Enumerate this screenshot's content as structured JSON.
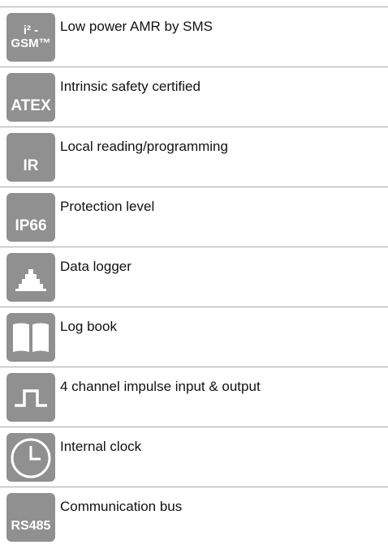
{
  "features": [
    {
      "badge": "i² -\nGSM™",
      "badge_line1": "i² -",
      "badge_line2": "GSM™",
      "label": "Low power AMR by SMS"
    },
    {
      "badge": "ATEX",
      "label": "Intrinsic safety certified"
    },
    {
      "badge": "IR",
      "label": "Local reading/programming"
    },
    {
      "badge": "IP66",
      "label": "Protection level"
    },
    {
      "icon": "data-logger-icon",
      "label": "Data logger"
    },
    {
      "icon": "log-book-icon",
      "label": "Log book"
    },
    {
      "icon": "impulse-signal-icon",
      "label": "4 channel impulse input & output"
    },
    {
      "icon": "clock-icon",
      "label": "Internal clock"
    },
    {
      "badge": "RS485",
      "label": "Communication bus"
    }
  ],
  "colors": {
    "icon_bg": "#909090",
    "icon_fg": "#ffffff",
    "rule": "#a8a8a8",
    "text": "#111111"
  }
}
